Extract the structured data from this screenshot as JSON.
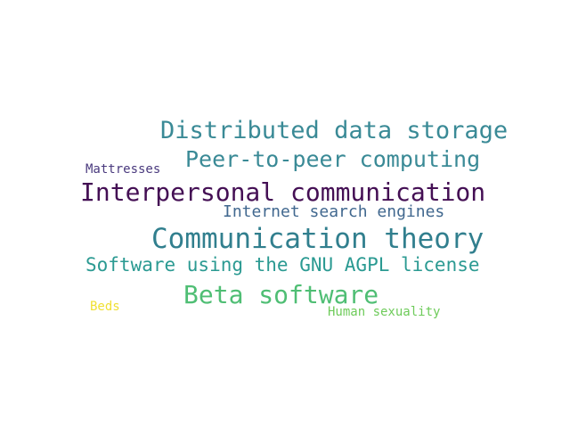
{
  "words": [
    {
      "text": "Distributed data storage",
      "color": "#3a8a96"
    },
    {
      "text": "Peer-to-peer computing",
      "color": "#3a8a96"
    },
    {
      "text": "Mattresses",
      "color": "#4a3a7e"
    },
    {
      "text": "Interpersonal communication",
      "color": "#440f54"
    },
    {
      "text": "Internet search engines",
      "color": "#41688f"
    },
    {
      "text": "Communication theory",
      "color": "#317f8e"
    },
    {
      "text": "Software using the GNU AGPL license",
      "color": "#2b9a92"
    },
    {
      "text": "Beta software",
      "color": "#4fbe74"
    },
    {
      "text": "Beds",
      "color": "#f0e033"
    },
    {
      "text": "Human sexuality",
      "color": "#6ecb5a"
    }
  ]
}
